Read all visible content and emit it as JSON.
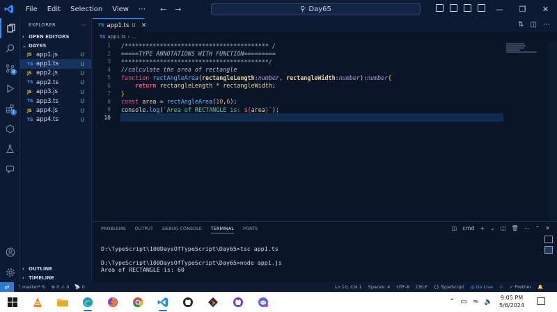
{
  "window": {
    "menu": [
      "File",
      "Edit",
      "Selection",
      "View",
      "⋯"
    ],
    "search_text": "Day65",
    "icons": {
      "logo": "vscode-logo-icon",
      "search": "search-icon"
    }
  },
  "activity_bar": {
    "items": [
      "explorer-icon",
      "search-icon",
      "source-control-icon",
      "run-debug-icon",
      "extensions-icon",
      "remote-explorer-icon",
      "testing-icon",
      "chat-icon"
    ],
    "badges": {
      "source_control": "8",
      "extensions": "1"
    },
    "bottom": [
      "account-icon",
      "settings-icon"
    ]
  },
  "sidebar": {
    "title": "EXPLORER",
    "more": "⋯",
    "open_editors": "OPEN EDITORS",
    "folder": "DAY65",
    "files": [
      {
        "ext": "JS",
        "name": "app1.js",
        "status": "U"
      },
      {
        "ext": "TS",
        "name": "app1.ts",
        "status": "U"
      },
      {
        "ext": "JS",
        "name": "app2.js",
        "status": "U"
      },
      {
        "ext": "TS",
        "name": "app2.ts",
        "status": "U"
      },
      {
        "ext": "JS",
        "name": "app3.js",
        "status": "U"
      },
      {
        "ext": "TS",
        "name": "app3.ts",
        "status": "U"
      },
      {
        "ext": "JS",
        "name": "app4.js",
        "status": "U"
      },
      {
        "ext": "TS",
        "name": "app4.ts",
        "status": "U"
      }
    ],
    "outline": "OUTLINE",
    "timeline": "TIMELINE"
  },
  "editor": {
    "tab": {
      "ext": "TS",
      "name": "app1.ts",
      "status": "U"
    },
    "breadcrumb": {
      "ext": "TS",
      "file": "app1.ts",
      "rest": "› ..."
    },
    "current_line": 10
  },
  "panel": {
    "tabs": [
      "PROBLEMS",
      "OUTPUT",
      "DEBUG CONSOLE",
      "TERMINAL",
      "PORTS"
    ],
    "active_tab": "TERMINAL",
    "shell": "cmd",
    "terminal_lines": [
      "D:\\TypeScript\\100DaysOfTypeScript\\Day65>tsc app1.ts",
      "",
      "D:\\TypeScript\\100DaysOfTypeScript\\Day65>node app1.js",
      "Area of RECTANGLE is: 60"
    ]
  },
  "status_bar": {
    "branch": "master*",
    "errors": "0",
    "warnings": "0",
    "ports": "0",
    "position": "Ln 10, Col 1",
    "spaces": "Spaces: 4",
    "encoding": "UTF-8",
    "eol": "CRLF",
    "language": "TypeScript",
    "golive": "Go Live",
    "prettier": "Prettier"
  },
  "taskbar": {
    "time": "9:05 PM",
    "date": "5/6/2024",
    "apps": [
      "windows-start-icon",
      "vlc-icon",
      "file-explorer-icon",
      "edge-icon",
      "firefox-icon",
      "chrome-icon",
      "vscode-icon",
      "github-desktop-icon",
      "git-icon",
      "github-icon",
      "discord-icon"
    ]
  }
}
